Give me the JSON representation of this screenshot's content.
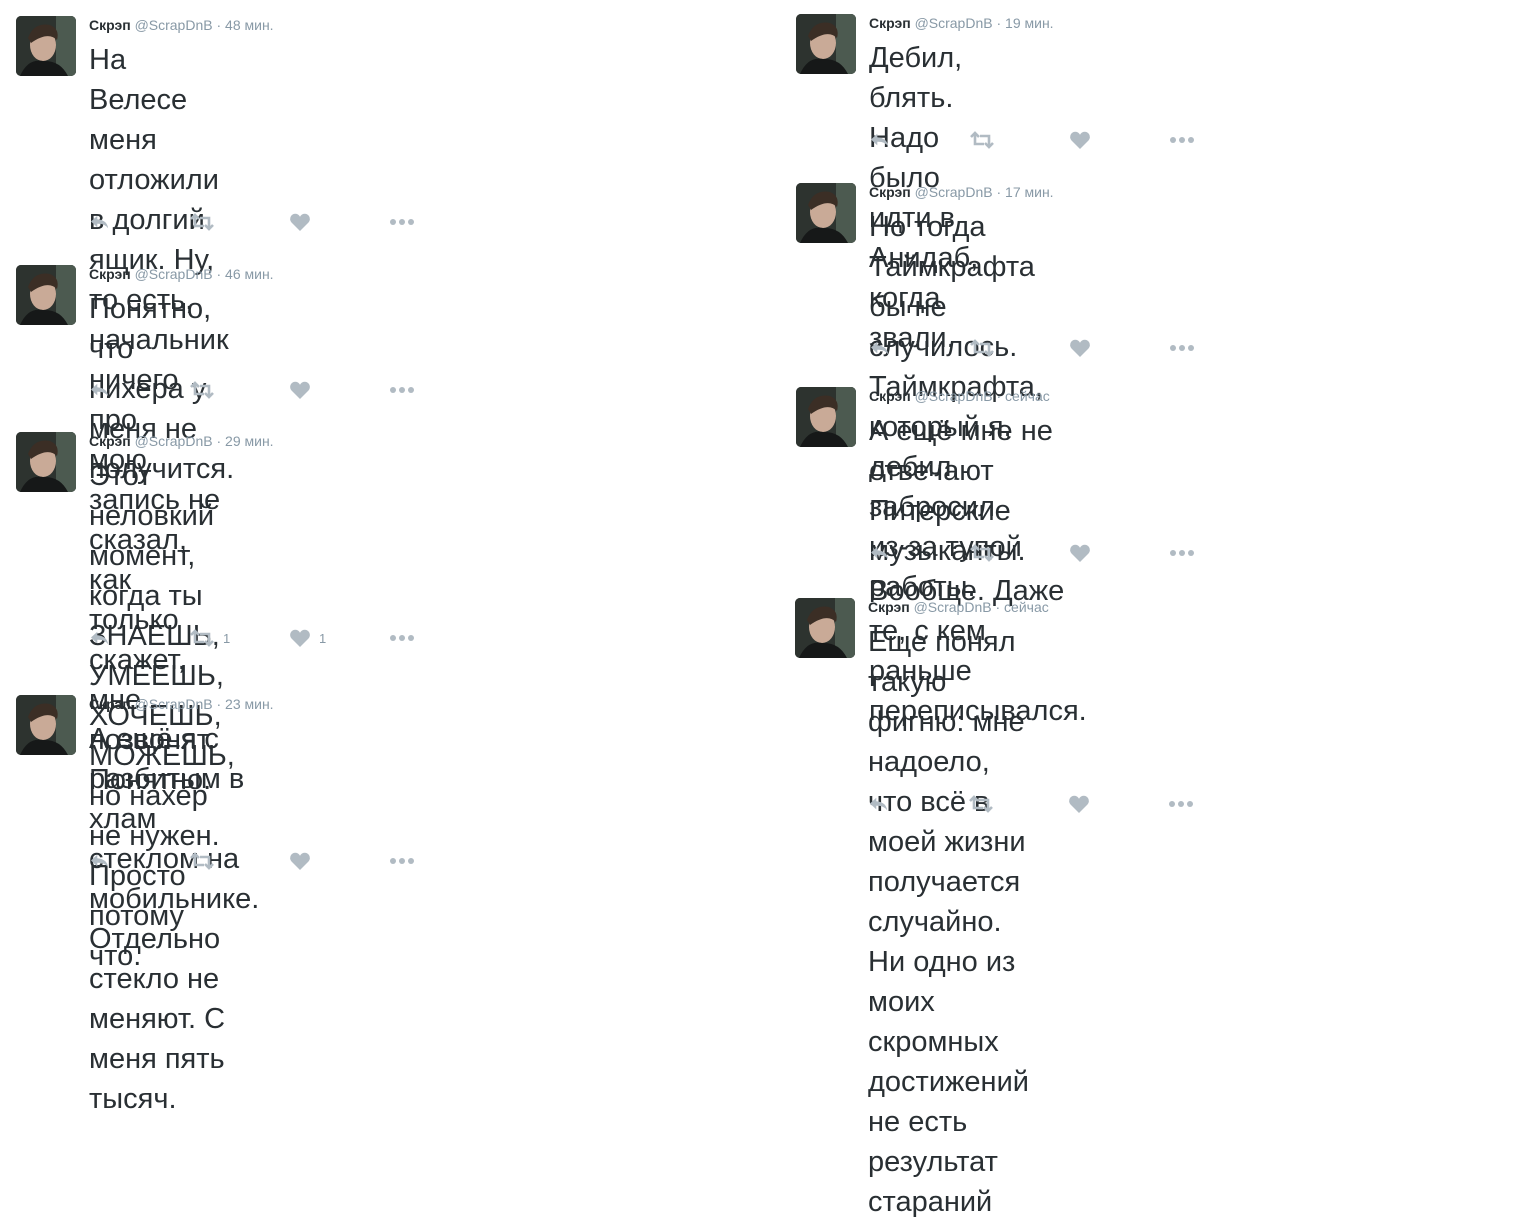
{
  "colors": {
    "text": "#292f33",
    "muted": "#8899a6",
    "icon": "#b1bbc3"
  },
  "user": {
    "name": "Скрэп",
    "handle": "@ScrapDnB",
    "dot": "·"
  },
  "icons": {
    "reply": "reply-icon",
    "retweet": "retweet-icon",
    "like": "heart-icon",
    "more": "more-icon"
  },
  "tweets": [
    {
      "time": "48 мин.",
      "text": "На Велесе меня отложили в долгий\nящик. Ну, то есть, начальник ничего про\nмою запись не сказал, как только скажет,\nмне позвонят. Понятно.",
      "retweets": "",
      "likes": ""
    },
    {
      "time": "46 мин.",
      "text": "Понятно, что нихера у меня не\nполучится.",
      "retweets": "",
      "likes": ""
    },
    {
      "time": "29 мин.",
      "text": "Этот неловкий момент, когда ты\nЗНАЕШЬ, УМЕЕШЬ, ХОЧЕШЬ,\nМОЖЕШЬ, но нахер не нужен. Просто\nпотому что.",
      "retweets": "1",
      "likes": "1"
    },
    {
      "time": "23 мин.",
      "text": "А ещё я с разбитым в хлам стеклом на\nмобильнике. Отдельно стекло не\nменяют. С меня пять тысяч.",
      "retweets": "",
      "likes": ""
    },
    {
      "time": "19 мин.",
      "text": "Дебил, блять. Надо было идти в Анидаб,\nкогда звали.",
      "retweets": "",
      "likes": ""
    },
    {
      "time": "17 мин.",
      "text": "Но тогда Таймкрафта бы не случилось.\nТаймкрафта, который я, дебил, забросил\nиз-за тупой работы.",
      "retweets": "",
      "likes": ""
    },
    {
      "time": "сейчас",
      "text": "А ещё мне не отвечают Питерские\nмузыканты. Вообще. Даже те, с кем\nраньше переписывался.",
      "retweets": "",
      "likes": ""
    },
    {
      "time": "сейчас",
      "text": "Еще понял такую фигню: мне надоело,\nчто всё в моей жизни получается\nслучайно. Ни одно из моих скромных\nдостижений не есть результат стараний",
      "retweets": "",
      "likes": ""
    }
  ]
}
